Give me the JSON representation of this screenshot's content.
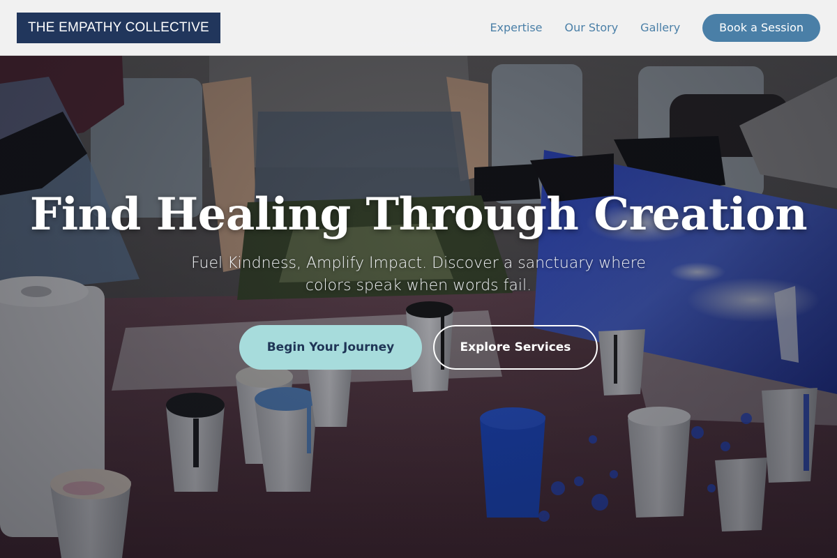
{
  "header": {
    "logo_text": "THE EMPATHY COLLECTIVE",
    "nav": [
      {
        "label": "Expertise"
      },
      {
        "label": "Our Story"
      },
      {
        "label": "Gallery"
      }
    ],
    "cta_label": "Book a Session"
  },
  "hero": {
    "headline": "Find Healing Through Creation",
    "subtext": "Fuel Kindness, Amplify Impact. Discover a sanctuary where colors speak when words fail.",
    "primary_cta": "Begin Your Journey",
    "secondary_cta": "Explore Services",
    "background_image": "Art therapy workshop table with plastic cups of paint and a blue poured-paint canvas"
  },
  "colors": {
    "brand_navy": "#21365c",
    "nav_link": "#4a7fa7",
    "cta_blue": "#4a7fa7",
    "primary_button": "#a7dcdc",
    "primary_button_text": "#1f3556"
  }
}
